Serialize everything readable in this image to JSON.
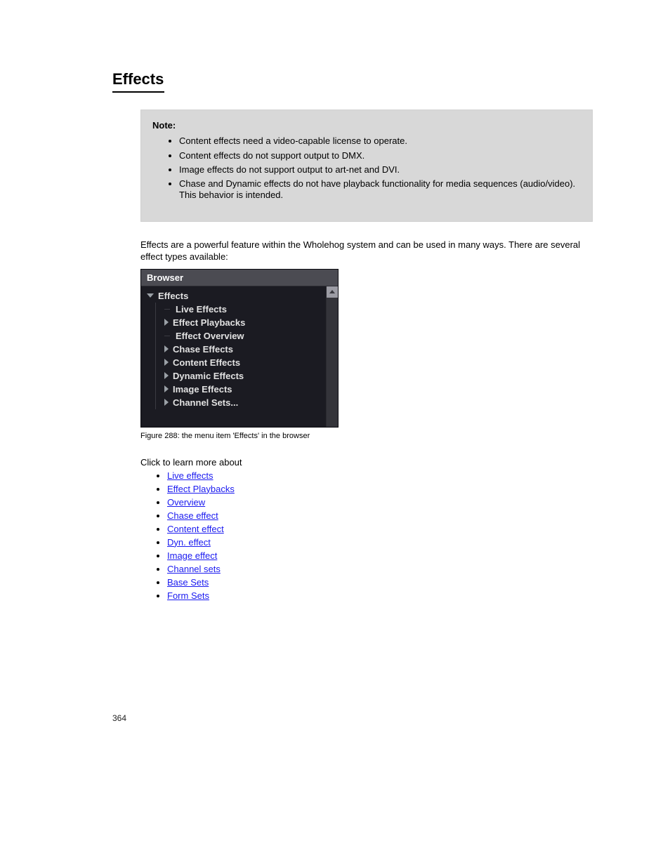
{
  "title": "Effects",
  "note": {
    "label": "Note:",
    "items": [
      "Content effects need a video-capable license to operate.",
      "Content effects do not support output to DMX.",
      "Image effects do not support output to art-net and DVI.",
      "Chase and Dynamic effects do not have playback functionality for media sequences (audio/video). This behavior is intended."
    ]
  },
  "para1": "Effects are a powerful feature within the Wholehog system and can be used in many ways. There are several effect types available:",
  "panel": {
    "title": "Browser",
    "root": "Effects",
    "items": [
      {
        "label": "Live Effects",
        "expandable": false
      },
      {
        "label": "Effect Playbacks",
        "expandable": true
      },
      {
        "label": "Effect Overview",
        "expandable": false
      },
      {
        "label": "Chase Effects",
        "expandable": true
      },
      {
        "label": "Content Effects",
        "expandable": true
      },
      {
        "label": "Dynamic Effects",
        "expandable": true
      },
      {
        "label": "Image Effects",
        "expandable": true
      },
      {
        "label": "Channel Sets...",
        "expandable": true
      }
    ]
  },
  "figure": "Figure 288: the menu item 'Effects' in the browser",
  "listIntro": "Click to learn more about",
  "links": [
    "Live effects",
    "Effect Playbacks",
    "Overview",
    "Chase effect",
    "Content effect",
    "Dyn. effect",
    "Image effect",
    "Channel sets",
    "Base Sets",
    "Form Sets"
  ],
  "footer": "364"
}
